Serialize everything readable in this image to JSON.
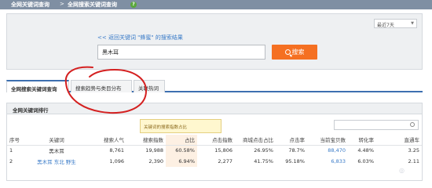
{
  "breadcrumb": {
    "level1": "全网关键词查询",
    "separator": ">",
    "level2": "全网搜索关键词查询",
    "help_icon": "?"
  },
  "search": {
    "back_link": "<< 返回关键词 \"蜂蜜\" 的搜索结果",
    "keyword_value": "黑木耳",
    "button_label": "搜索",
    "date_range": "最近7天"
  },
  "tabs": [
    {
      "label": "全网搜索关键词查询",
      "active": true
    },
    {
      "label": "搜索趋势与类目分布",
      "active": false
    },
    {
      "label": "关联热词",
      "active": false
    }
  ],
  "ranking": {
    "title": "全网关键词排行",
    "tooltip": "关键词的搜索指数占比",
    "columns": [
      "序号",
      "关键词",
      "搜索人气",
      "搜索指数",
      "占比",
      "点击指数",
      "商城点击占比",
      "点击率",
      "当前宝贝数",
      "转化率",
      "直通车"
    ],
    "rows": [
      [
        "1",
        "黑木耳",
        "8,761",
        "19,988",
        "60.58%",
        "15,806",
        "26.95%",
        "78.7%",
        "88,470",
        "4.48%",
        "3.25"
      ],
      [
        "2",
        "黑木耳 东北 野生",
        "1,096",
        "2,390",
        "6.94%",
        "2,277",
        "41.75%",
        "95.18%",
        "6,833",
        "6.03%",
        "2.11"
      ]
    ]
  },
  "annotation_color": "#d42020"
}
